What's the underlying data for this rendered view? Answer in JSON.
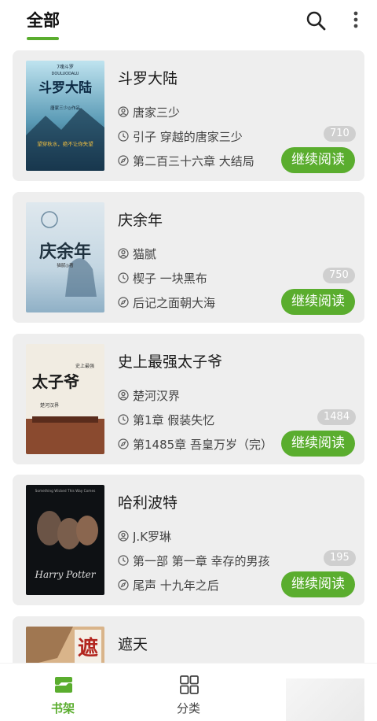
{
  "header": {
    "tab_label": "全部"
  },
  "colors": {
    "accent": "#5aad2e",
    "card_bg": "#eeeeee",
    "badge_bg": "#cfcfcf"
  },
  "icons": {
    "search": "search-icon",
    "more": "more-vertical-icon",
    "author": "person-icon",
    "recent": "clock-icon",
    "latest": "compass-icon",
    "shelf": "bookshelf-icon",
    "category": "grid-icon"
  },
  "books": [
    {
      "title": "斗罗大陆",
      "author": "唐家三少",
      "recent": "引子 穿越的唐家三少",
      "latest": "第二百三十六章 大结局",
      "count": "710",
      "action": "继续阅读",
      "cover": {
        "lines": [
          "7魂斗罗",
          "DOULUODALU",
          "斗罗大陆",
          "唐家三少◎作品",
          "望穿秋水，绝不让你失望"
        ]
      }
    },
    {
      "title": "庆余年",
      "author": "猫腻",
      "recent": "楔子 一块黑布",
      "latest": "后记之面朝大海",
      "count": "750",
      "action": "继续阅读",
      "cover": {
        "lines": [
          "庆余年",
          "猫腻◎著"
        ]
      }
    },
    {
      "title": "史上最强太子爷",
      "author": "楚河汉界",
      "recent": "第1章 假装失忆",
      "latest": "第1485章 吾皇万岁（完）",
      "count": "1484",
      "action": "继续阅读",
      "cover": {
        "lines": [
          "太子爷",
          "史上最强",
          "楚河汉界"
        ]
      }
    },
    {
      "title": "哈利波特",
      "author": "J.K罗琳",
      "recent": "第一部 第一章 幸存的男孩",
      "latest": "尾声 十九年之后",
      "count": "195",
      "action": "继续阅读",
      "cover": {
        "lines": [
          "Something Wicked This Way Comes",
          "Harry Potter"
        ]
      }
    },
    {
      "title": "遮天",
      "author": "",
      "recent": "",
      "latest": "",
      "count": "",
      "action": "",
      "cover": {
        "lines": [
          "遮"
        ]
      }
    }
  ],
  "nav": {
    "shelf_label": "书架",
    "category_label": "分类"
  }
}
